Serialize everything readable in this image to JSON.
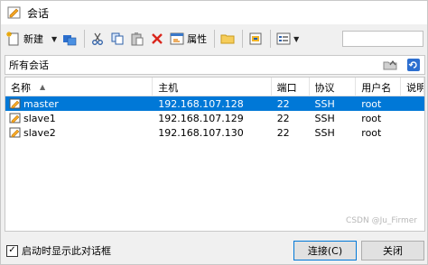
{
  "window": {
    "title": "会话"
  },
  "toolbar": {
    "new_label": "新建",
    "properties_label": "属性"
  },
  "pathbar": {
    "label": "所有会话"
  },
  "list": {
    "columns": [
      "名称",
      "主机",
      "端口",
      "协议",
      "用户名",
      "说明"
    ],
    "rows": [
      {
        "name": "master",
        "host": "192.168.107.128",
        "port": "22",
        "protocol": "SSH",
        "user": "root",
        "selected": true
      },
      {
        "name": "slave1",
        "host": "192.168.107.129",
        "port": "22",
        "protocol": "SSH",
        "user": "root",
        "selected": false
      },
      {
        "name": "slave2",
        "host": "192.168.107.130",
        "port": "22",
        "protocol": "SSH",
        "user": "root",
        "selected": false
      }
    ]
  },
  "footer": {
    "show_on_startup_label": "启动时显示此对话框",
    "show_on_startup_checked": true,
    "connect_label": "连接(C)",
    "close_label": "关闭"
  },
  "watermark": "CSDN @Ju_Firmer",
  "colors": {
    "selection": "#0078d7",
    "window_bg": "#f0f0f0"
  }
}
